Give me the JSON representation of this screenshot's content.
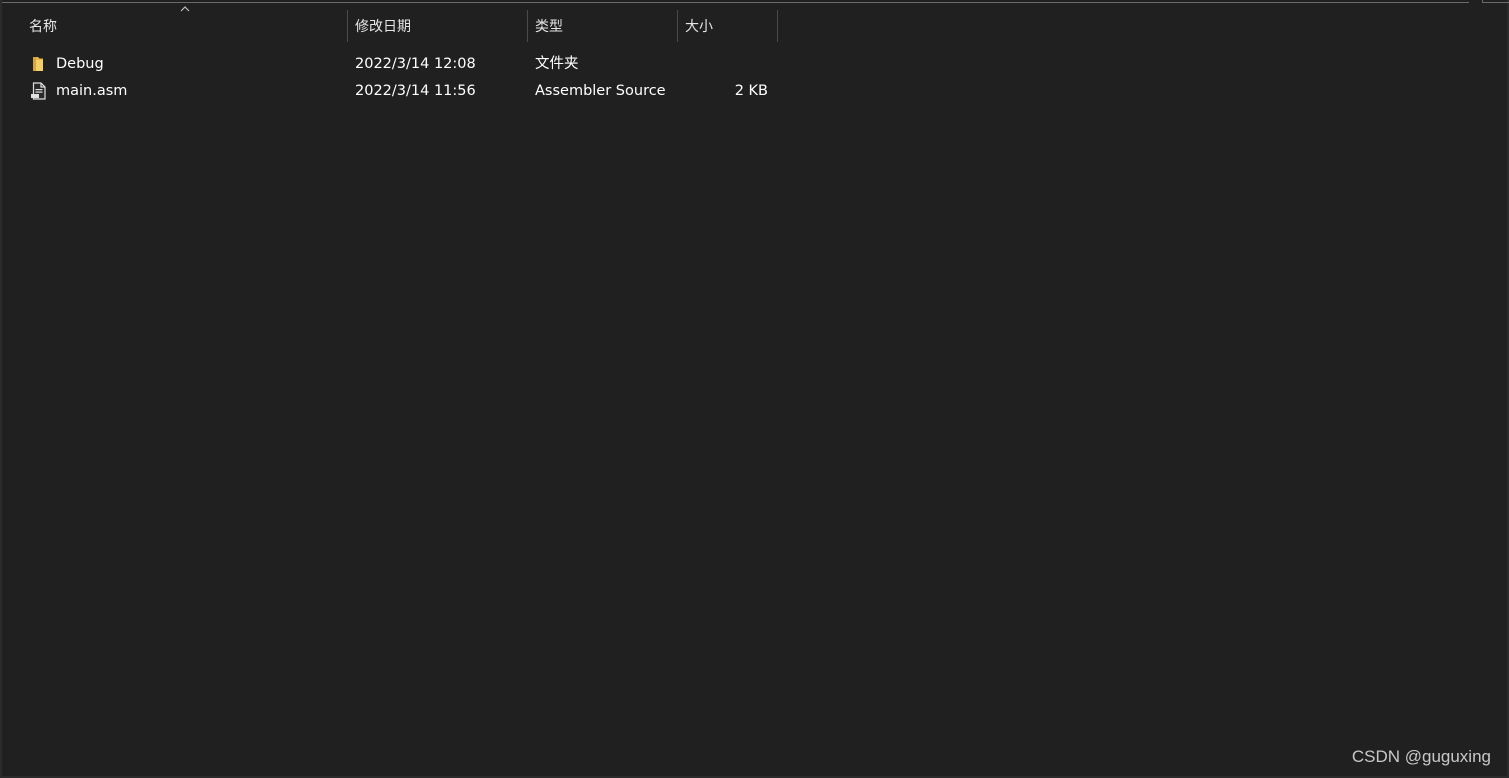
{
  "columns": {
    "name": "名称",
    "modified": "修改日期",
    "type": "类型",
    "size": "大小"
  },
  "sort": {
    "column": "name",
    "direction": "ascending",
    "icon": "chevron-up-icon"
  },
  "files": [
    {
      "name": "Debug",
      "modified": "2022/3/14 12:08",
      "type": "文件夹",
      "size": "",
      "icon": "folder-icon"
    },
    {
      "name": "main.asm",
      "modified": "2022/3/14 11:56",
      "type": "Assembler Source",
      "size": "2 KB",
      "icon": "asm-file-icon"
    }
  ],
  "watermark": "CSDN @guguxing",
  "colors": {
    "background": "#202020",
    "folder": "#e8b94a",
    "text": "#ffffff"
  }
}
